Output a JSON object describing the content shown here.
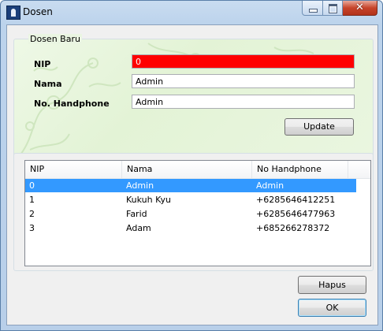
{
  "window": {
    "title": "Dosen"
  },
  "caption": {
    "close_glyph": "✕"
  },
  "form": {
    "group_label": "Dosen Baru",
    "nip": {
      "label": "NIP",
      "value": "0"
    },
    "nama": {
      "label": "Nama",
      "value": "Admin"
    },
    "handphone": {
      "label": "No. Handphone",
      "value": "Admin"
    },
    "update_label": "Update"
  },
  "list": {
    "columns": [
      "NIP",
      "Nama",
      "No Handphone"
    ],
    "rows": [
      [
        "0",
        "Admin",
        "Admin"
      ],
      [
        "1",
        "Kukuh Kyu",
        "+6285646412251"
      ],
      [
        "2",
        "Farid",
        "+6285646477963"
      ],
      [
        "3",
        "Adam",
        "+685266278372"
      ]
    ],
    "selected_index": 0
  },
  "buttons": {
    "hapus_label": "Hapus",
    "ok_label": "OK"
  },
  "colors": {
    "nip_field_bg": "#ff0000",
    "selection": "#3399ff",
    "close_button": "#c7442b"
  },
  "icons": {
    "app": "user-app-icon"
  }
}
